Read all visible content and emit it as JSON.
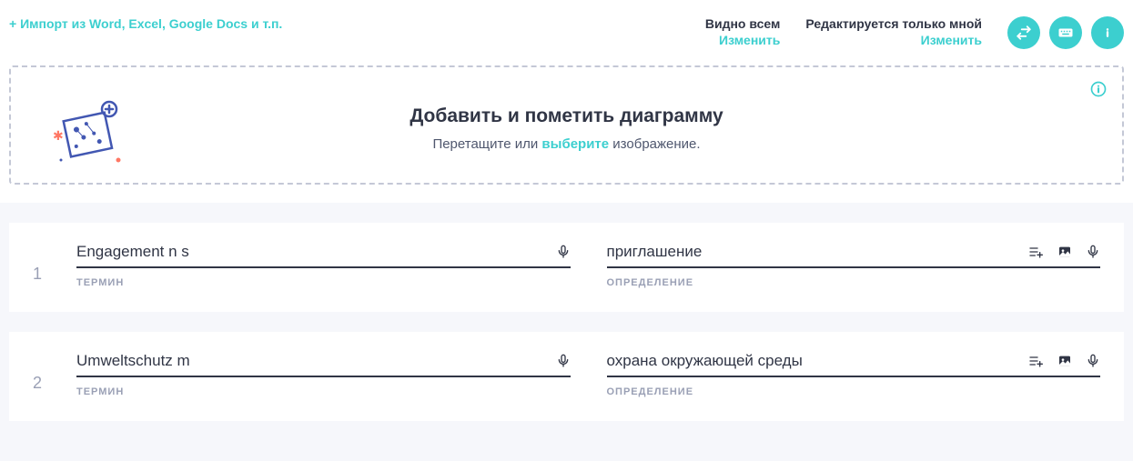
{
  "topbar": {
    "import_link": "+ Импорт из Word, Excel, Google Docs и т.п.",
    "visibility": {
      "visible_label": "Видно всем",
      "editable_label": "Редактируется только мной",
      "change_label": "Изменить"
    }
  },
  "dropzone": {
    "title": "Добавить и пометить диаграмму",
    "sub_prefix": "Перетащите или ",
    "sub_link": "выберите",
    "sub_suffix": " изображение."
  },
  "cards": [
    {
      "number": "1",
      "term": "Engagement n s",
      "definition": "приглашение",
      "term_label": "ТЕРМИН",
      "def_label": "ОПРЕДЕЛЕНИЕ"
    },
    {
      "number": "2",
      "term": "Umweltschutz m",
      "definition": "охрана окружающей среды",
      "term_label": "ТЕРМИН",
      "def_label": "ОПРЕДЕЛЕНИЕ"
    }
  ]
}
